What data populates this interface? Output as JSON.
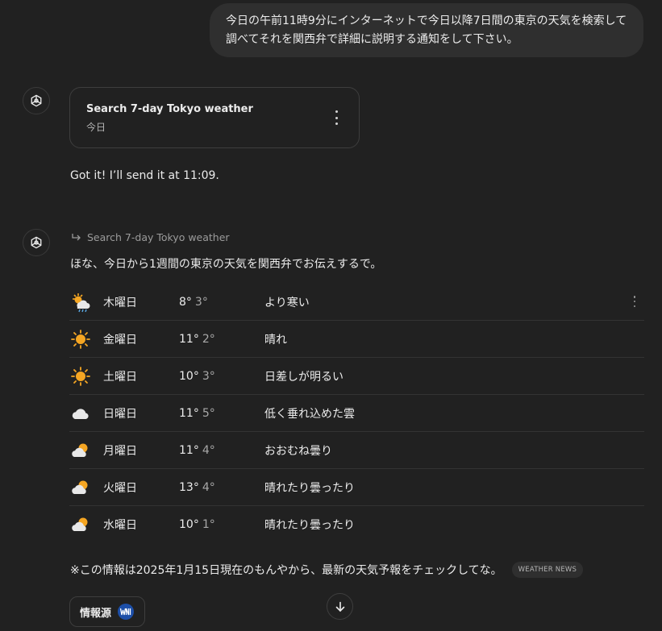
{
  "user_message": "今日の午前11時9分にインターネットで今日以降7日間の東京の天気を検索して調べてそれを関西弁で詳細に説明する通知をして下さい。",
  "task_card": {
    "title": "Search 7-day Tokyo weather",
    "subtitle": "今日"
  },
  "confirmation": "Got it! I’ll send it at 11:09.",
  "task_link": "Search 7-day Tokyo weather",
  "intro": "ほな、今日から1週間の東京の天気を関西弁でお伝えするで。",
  "forecast": [
    {
      "day": "木曜日",
      "high": "8°",
      "low": "3°",
      "condition": "より寒い",
      "icon": "sun-cloud-rain-icon"
    },
    {
      "day": "金曜日",
      "high": "11°",
      "low": "2°",
      "condition": "晴れ",
      "icon": "sun-icon"
    },
    {
      "day": "土曜日",
      "high": "10°",
      "low": "3°",
      "condition": "日差しが明るい",
      "icon": "sun-icon"
    },
    {
      "day": "日曜日",
      "high": "11°",
      "low": "5°",
      "condition": "低く垂れ込めた雲",
      "icon": "cloud-icon"
    },
    {
      "day": "月曜日",
      "high": "11°",
      "low": "4°",
      "condition": "おおむね曇り",
      "icon": "partly-cloudy-icon"
    },
    {
      "day": "火曜日",
      "high": "13°",
      "low": "4°",
      "condition": "晴れたり曇ったり",
      "icon": "partly-cloudy-icon"
    },
    {
      "day": "水曜日",
      "high": "10°",
      "low": "1°",
      "condition": "晴れたり曇ったり",
      "icon": "partly-cloudy-icon"
    }
  ],
  "footnote": "※この情報は2025年1月15日現在のもんやから、最新の天気予報をチェックしてな。",
  "source_chip": "WEATHER NEWS",
  "sources_label": "情報源",
  "colors": {
    "background": "#212121",
    "bubble": "#2f2f2f",
    "sun": "#f5a623",
    "cloud": "#e8e8e8",
    "wni_logo": "#1d4fa8"
  }
}
